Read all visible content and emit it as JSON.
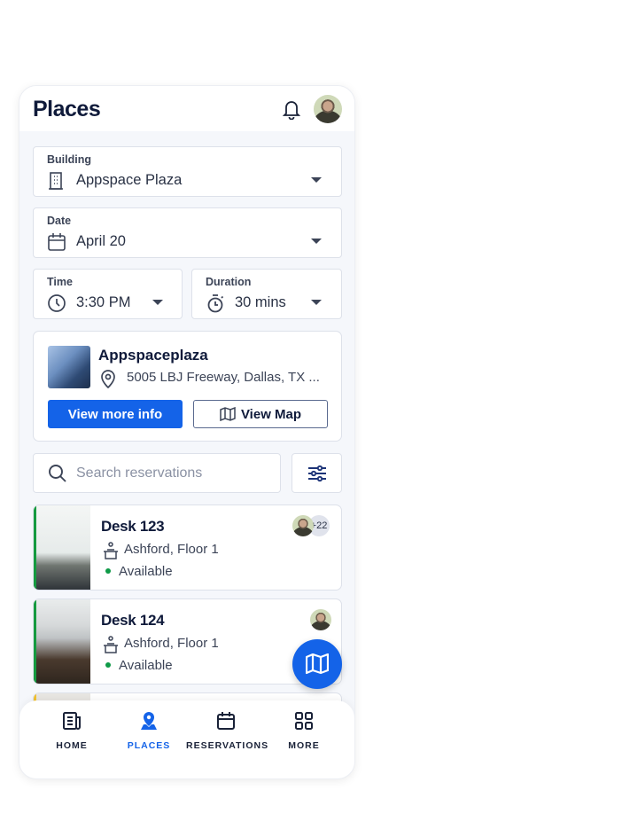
{
  "header": {
    "title": "Places",
    "bell_icon": "bell-icon",
    "avatar": "user-avatar"
  },
  "filters": {
    "building": {
      "label": "Building",
      "value": "Appspace Plaza",
      "icon": "building-icon"
    },
    "date": {
      "label": "Date",
      "value": "April 20",
      "icon": "calendar-icon"
    },
    "time": {
      "label": "Time",
      "value": "3:30 PM",
      "icon": "clock-icon"
    },
    "duration": {
      "label": "Duration",
      "value": "30 mins",
      "icon": "timer-icon"
    }
  },
  "building_card": {
    "name": "Appspaceplaza",
    "address": "5005 LBJ Freeway, Dallas, TX ...",
    "view_more_label": "View more info",
    "view_map_label": "View Map"
  },
  "search": {
    "placeholder": "Search reservations"
  },
  "desks": [
    {
      "name": "Desk 123",
      "location": "Ashford, Floor 1",
      "status": "Available",
      "extra_count": "+22",
      "status_color": "#0e9a47"
    },
    {
      "name": "Desk 124",
      "location": "Ashford, Floor 1",
      "status": "Available",
      "status_color": "#0e9a47"
    }
  ],
  "nav": [
    {
      "label": "HOME",
      "icon": "newspaper-icon"
    },
    {
      "label": "PLACES",
      "icon": "map-pin-icon",
      "active": true
    },
    {
      "label": "RESERVATIONS",
      "icon": "calendar-icon"
    },
    {
      "label": "MORE",
      "icon": "grid-icon"
    }
  ],
  "colors": {
    "accent": "#1463e8",
    "available": "#0e9a47",
    "text": "#0f1a3a"
  }
}
